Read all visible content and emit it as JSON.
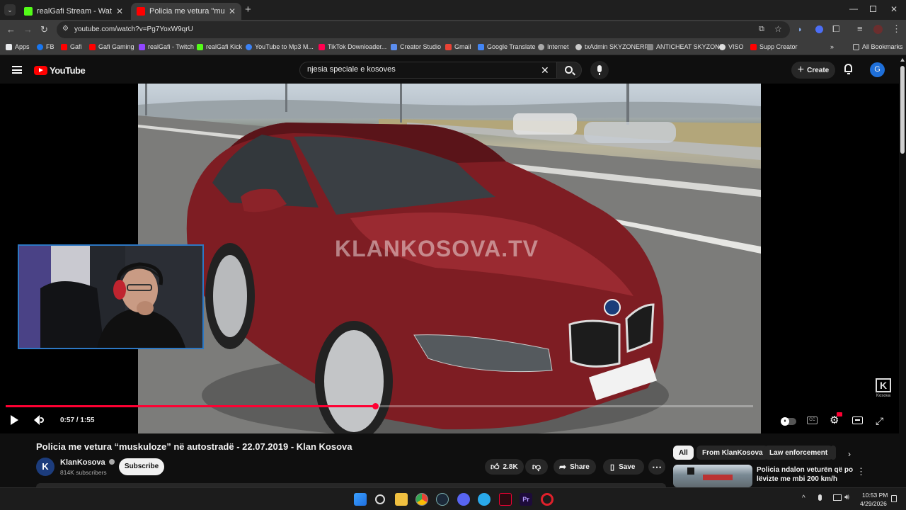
{
  "browser": {
    "tabs": [
      {
        "title": "realGafi Stream - Watch Live on",
        "active": false,
        "color": "#53fc18"
      },
      {
        "title": "Policia me vetura \"muskuloze\" n",
        "active": true,
        "color": "#ff0000"
      }
    ],
    "url": "youtube.com/watch?v=Pg7YoxW9qrU",
    "bookmarks": [
      {
        "label": "Apps",
        "color": "#e8eaed"
      },
      {
        "label": "FB",
        "color": "#1877f2"
      },
      {
        "label": "Gafi",
        "color": "#ff0000"
      },
      {
        "label": "Gafi Gaming",
        "color": "#ff0000"
      },
      {
        "label": "realGafi - Twitch",
        "color": "#9146ff"
      },
      {
        "label": "realGafi Kick",
        "color": "#53fc18"
      },
      {
        "label": "YouTube to Mp3 M...",
        "color": "#3b82f6"
      },
      {
        "label": "TikTok Downloader...",
        "color": "#ff0050"
      },
      {
        "label": "Creator Studio",
        "color": "#5b8def"
      },
      {
        "label": "Gmail",
        "color": "#ea4335"
      },
      {
        "label": "Google Translate",
        "color": "#4285f4"
      },
      {
        "label": "Internet",
        "color": "#aaaaaa"
      },
      {
        "label": "txAdmin SKYZONERP",
        "color": "#cccccc"
      },
      {
        "label": "ANTICHEAT SKYZONE",
        "color": "#888888"
      },
      {
        "label": "VISO",
        "color": "#dddddd"
      },
      {
        "label": "Supp Creator",
        "color": "#ff0000"
      }
    ],
    "all_bookmarks": "All Bookmarks"
  },
  "youtube": {
    "logo_text": "YouTube",
    "search_value": "njesia speciale e kosoves",
    "create_label": "Create",
    "avatar_letter": "G"
  },
  "player": {
    "watermark": "KLANKOSOVA.TV",
    "channel_bug": "Kosova",
    "time_current": "0:57",
    "time_total": "1:55",
    "progress": 0.494,
    "accent": "#ff0033"
  },
  "video": {
    "title": "Policia me vetura “muskuloze” në autostradë - 22.07.2019 - Klan Kosova",
    "channel": "KlanKosova",
    "subscribers": "814K subscribers",
    "subscribe_label": "Subscribe",
    "likes": "2.8K",
    "share_label": "Share",
    "save_label": "Save"
  },
  "sidebar": {
    "chips": [
      "All",
      "From KlanKosova",
      "Law enforcement"
    ],
    "rec_title_line1": "Policia ndalon veturën që po",
    "rec_title_line2": "lëvizte me mbi 200 km/h"
  },
  "taskbar": {
    "time": "10:53 PM",
    "date": "4/29/2026"
  }
}
